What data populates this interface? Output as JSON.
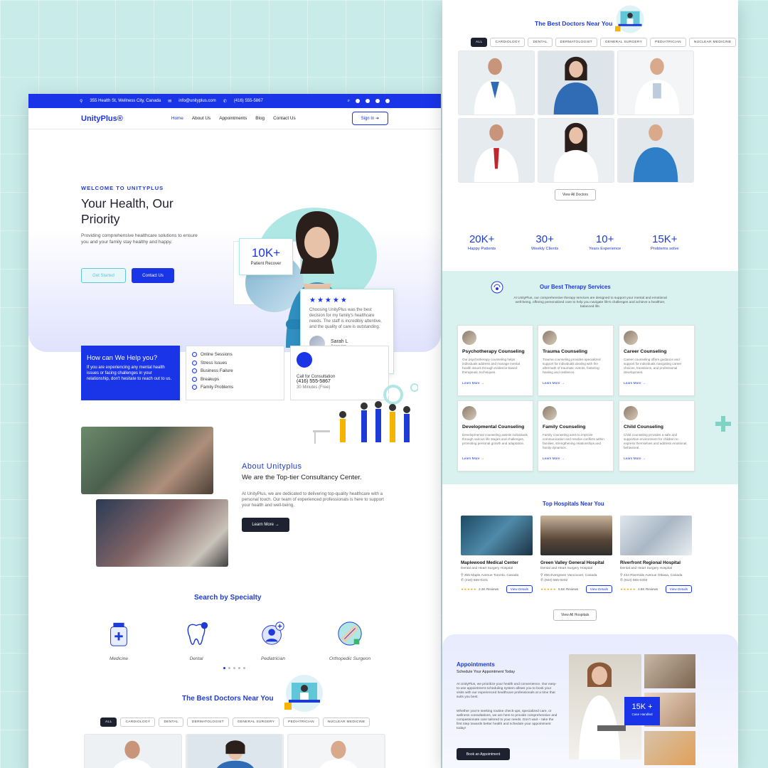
{
  "topbar": {
    "address": "355 Health St, Wellness City, Canada",
    "email": "info@unityplus.com",
    "phone": "(416) 555-5867"
  },
  "nav": {
    "logo": "UnityPlus®",
    "links": [
      "Home",
      "About Us",
      "Appointments",
      "Blog",
      "Contact Us"
    ],
    "signin": "Sign In"
  },
  "hero": {
    "eyebrow": "WELCOME TO UNITYPLUS",
    "title": "Your Health, Our Priority",
    "lead": "Providing comprehensive healthcare solutions to ensure you and your family stay healthy and happy.",
    "btn_primary": "Get Started",
    "btn_secondary": "Contact Us",
    "stat_value": "10K+",
    "stat_label": "Patient Recover",
    "review": {
      "stars": "★★★★★",
      "text": "Choosing UnityPlus was the best decision for my family's healthcare needs. The staff is incredibly attentive, and the quality of care is outstanding.",
      "name": "Sarah L",
      "role": "Accouter"
    }
  },
  "help": {
    "title": "How can We Help you?",
    "text": "If you are experiencing any mental health issues or facing challenges in your relationship, don't hesitate to reach out to us.",
    "items": [
      "Online Sessions",
      "Stress Issues",
      "Business Failure",
      "Breakups",
      "Family Problems"
    ],
    "call_title": "Call for Consultation",
    "call_number": "(416) 555-5867",
    "call_note": "30 Minutes (Free)"
  },
  "about": {
    "title": "About Unityplus",
    "subtitle": "We are the Top-tier Consultancy Center.",
    "text": "At UnityPlus, we are dedicated to delivering top-quality healthcare with a personal touch. Our team of experienced professionals is here to support your health and well-being.",
    "button": "Learn More →"
  },
  "specialty": {
    "title": "Search by Specialty",
    "items": [
      "Medicine",
      "Dental",
      "Pediatrician",
      "Orthopedic Surgeon"
    ]
  },
  "doctors": {
    "title": "The Best Doctors Near You",
    "filters": [
      "ALL",
      "CARDIOLOGY",
      "DENTAL",
      "DERMATOLOGIST",
      "GENERAL SURGERY",
      "PEDIATRICIAN",
      "NUCLEAR MEDICINE"
    ],
    "view_all": "View All Doctors"
  },
  "stats": [
    {
      "value": "20K+",
      "label": "Happy Patients"
    },
    {
      "value": "30+",
      "label": "Weekly Clients"
    },
    {
      "value": "10+",
      "label": "Years Experience"
    },
    {
      "value": "15K+",
      "label": "Problems solve"
    }
  ],
  "therapy": {
    "title": "Our Best Therapy Services",
    "text": "At UnityPlus, our comprehensive therapy services are designed to support your mental and emotional well-being, offering personalized care to help you navigate life's challenges and achieve a healthier, balanced life.",
    "cards": [
      {
        "title": "Psychotherapy Counseling",
        "text": "Our psychotherapy counseling helps individuals address and manage mental health issues through evidence-based therapeutic techniques.",
        "link": "Learn More"
      },
      {
        "title": "Trauma Counseling",
        "text": "Trauma counseling provides specialized support for individuals dealing with the aftermath of traumatic events, fostering healing and resilience.",
        "link": "Learn More"
      },
      {
        "title": "Career Counseling",
        "text": "Career counseling offers guidance and support for individuals navigating career choices, transitions, and professional development.",
        "link": "Learn More"
      },
      {
        "title": "Developmental Counseling",
        "text": "Developmental counseling assists individuals through various life stages and challenges, promoting personal growth and adaptation.",
        "link": "Learn More"
      },
      {
        "title": "Family Counseling",
        "text": "Family counseling aims to improve communication and resolve conflicts within families, strengthening relationships and family dynamics.",
        "link": "Learn More"
      },
      {
        "title": "Child Counseling",
        "text": "Child counseling provides a safe and supportive environment for children to express themselves and address emotional, behavioral.",
        "link": "Learn More"
      }
    ]
  },
  "hospitals": {
    "title": "Top Hospitals Near You",
    "view_all": "View All Hospitals",
    "items": [
      {
        "name": "Maplewood Medical Center",
        "sub": "Dental and Heart Surgery Hospital",
        "addr": "355 Maple Avenue Toronto, Canada",
        "phone": "(416) 555-0101",
        "stars": "★★★★★",
        "reviews": "2.3K Reviews",
        "button": "View Details"
      },
      {
        "name": "Green Valley General Hospital",
        "sub": "Dental and Heart Surgery Hospital",
        "addr": "456 Evergreen Vancouver, Canada",
        "phone": "(604) 555-0202",
        "stars": "★★★★★",
        "reviews": "5.5K Reviews",
        "button": "View Details"
      },
      {
        "name": "Riverfront Regional Hospital",
        "sub": "Dental and Heart Surgery Hospital",
        "addr": "234 Riverside Avenue Ottawa, Canada",
        "phone": "(613) 555-0303",
        "stars": "★★★★★",
        "reviews": "4.8K Reviews",
        "button": "View Details"
      }
    ]
  },
  "appointments": {
    "title": "Appointments",
    "subtitle": "Schedule Your Appointment Today",
    "text1": "At UnityPlus, we prioritize your health and convenience. Our easy-to-use appointment scheduling system allows you to book your visits with our experienced healthcare professionals at a time that suits you best.",
    "text2": "Whether you're seeking routine check-ups, specialized care, or wellness consultations, we are here to provide comprehensive and compassionate care tailored to your needs. Don't wait – take the first step towards better health and schedule your appointment today!",
    "button": "Book an Appointment",
    "stat_value": "15K +",
    "stat_label": "Case Handled"
  }
}
